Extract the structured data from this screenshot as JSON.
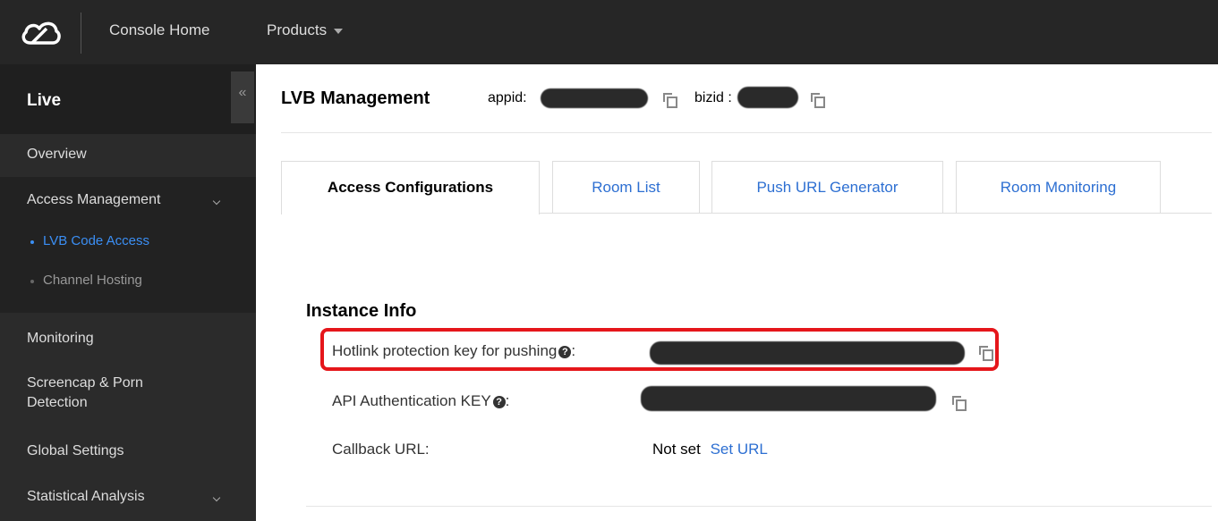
{
  "topbar": {
    "logo_icon": "cloud-logo-icon",
    "console_home": "Console Home",
    "products": "Products"
  },
  "sidebar": {
    "title": "Live",
    "collapse_glyph": "«",
    "items": [
      {
        "label": "Overview"
      },
      {
        "label": "Access Management",
        "expanded": true,
        "children": [
          {
            "label": "LVB Code Access",
            "active": true
          },
          {
            "label": "Channel Hosting"
          }
        ]
      },
      {
        "label": "Monitoring"
      },
      {
        "label": "Screencap & Porn Detection"
      },
      {
        "label": "Global Settings"
      },
      {
        "label": "Statistical Analysis",
        "expandable": true
      }
    ]
  },
  "main": {
    "title": "LVB Management",
    "appid_label": "appid:",
    "bizid_label": "bizid :",
    "tabs": [
      {
        "label": "Access Configurations",
        "active": true
      },
      {
        "label": "Room List"
      },
      {
        "label": "Push URL Generator"
      },
      {
        "label": "Room Monitoring"
      }
    ],
    "section_title": "Instance Info",
    "rows": [
      {
        "label": "Hotlink protection key for pushing",
        "suffix": ":"
      },
      {
        "label": "API Authentication KEY",
        "suffix": ":"
      },
      {
        "label": "Callback URL:"
      }
    ],
    "callback_value": "Not set",
    "callback_link": "Set URL"
  },
  "colors": {
    "topbar_bg": "#262626",
    "sidebar_bg": "#2b2b2b",
    "accent_link": "#2d6fd2",
    "active_nav": "#3b8ff5",
    "highlight_border": "#e5161b"
  }
}
